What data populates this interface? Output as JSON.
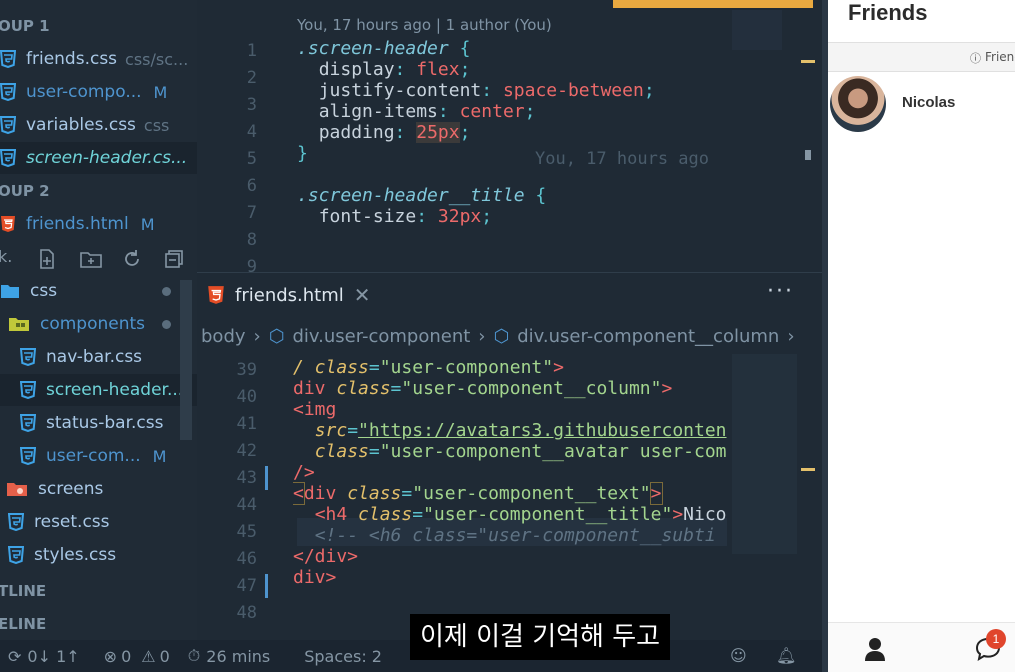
{
  "sidebar": {
    "group1": "OUP 1",
    "group2": "OUP 2",
    "open_editors": [
      {
        "name": "friends.css",
        "desc": "css/sc..."
      },
      {
        "name": "user-compo...",
        "badge": "M"
      },
      {
        "name": "variables.css",
        "desc": "css"
      },
      {
        "name": "screen-header.cs..."
      }
    ],
    "group2_files": [
      {
        "name": "friends.html",
        "badge": "M"
      }
    ],
    "tree": [
      {
        "name": "css"
      },
      {
        "name": "components"
      },
      {
        "name": "nav-bar.css"
      },
      {
        "name": "screen-header...."
      },
      {
        "name": "status-bar.css"
      },
      {
        "name": "user-com...",
        "badge": "M"
      },
      {
        "name": "screens"
      },
      {
        "name": "reset.css"
      },
      {
        "name": "styles.css"
      }
    ],
    "outline": "TLINE",
    "timeline": "ELINE"
  },
  "top_editor": {
    "blame": "You, 17 hours ago | 1 author (You)",
    "inline_blame": "You, 17 hours ago",
    "lines": [
      "1",
      "2",
      "3",
      "4",
      "5",
      "6",
      "7",
      "8",
      "9"
    ]
  },
  "bottom_editor": {
    "tab_label": "friends.html",
    "breadcrumb": [
      "body",
      "div.user-component",
      "div.user-component__column"
    ],
    "lines": [
      "39",
      "40",
      "41",
      "42",
      "43",
      "44",
      "45",
      "46",
      "47",
      "48"
    ]
  },
  "statusbar": {
    "sync": "0↓ 1↑",
    "errors": "0",
    "warnings": "0",
    "time": "26 mins",
    "spaces": "Spaces: 2"
  },
  "friends_panel": {
    "title": "Friends",
    "notice": "Frienc",
    "user_name": "Nicolas",
    "badge_count": "1"
  },
  "subtitle": "이제 이걸 기억해 두고",
  "colors": {
    "accent": "#4e94ce",
    "badge": "#e0452c"
  }
}
